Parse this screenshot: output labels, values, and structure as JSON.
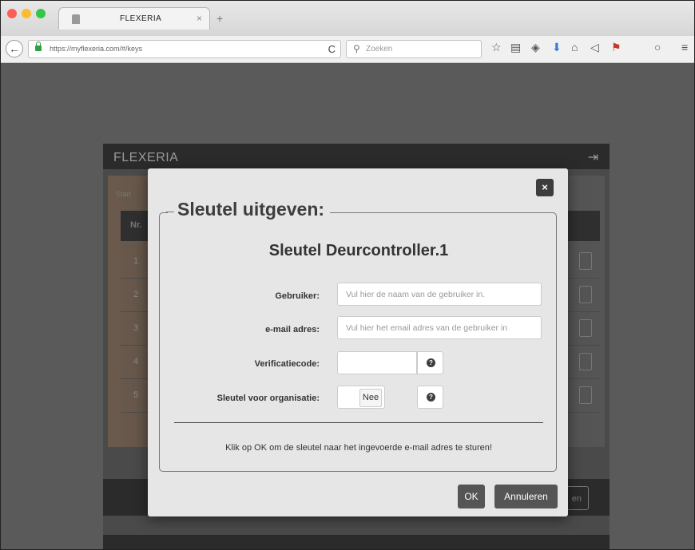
{
  "browser": {
    "tab_title": "FLEXERIA",
    "tab_close": "×",
    "new_tab": "+",
    "url": "https://myflexeria.com/#/keys",
    "reload": "C",
    "search_placeholder": "Zoeken",
    "toolbar_icons": [
      "star-icon",
      "reading-list-icon",
      "pocket-icon",
      "download-icon",
      "home-icon",
      "send-icon",
      "translate-icon",
      "chat-icon",
      "menu-icon"
    ]
  },
  "app": {
    "brand": "FLEXERIA",
    "bg_tab": "Start",
    "bg_header": "Nr.",
    "bg_rows": [
      "1",
      "2",
      "3",
      "4",
      "5"
    ],
    "bg_footer_button": "en"
  },
  "modal": {
    "close": "×",
    "legend": "Sleutel uitgeven:",
    "key_title": "Sleutel Deurcontroller.1",
    "user_label": "Gebruiker:",
    "user_placeholder": "Vul hier de naam van de gebruiker in.",
    "email_label": "e-mail adres:",
    "email_placeholder": "Vul hier het email adres van de gebruiker in",
    "code_label": "Verificatiecode:",
    "code_value": "",
    "org_label": "Sleutel voor organisatie:",
    "org_value": "Nee",
    "help_symbol": "?",
    "note": "Klik op OK om de sleutel naar het ingevoerde e-mail adres te sturen!",
    "ok_label": "OK",
    "cancel_label": "Annuleren"
  }
}
